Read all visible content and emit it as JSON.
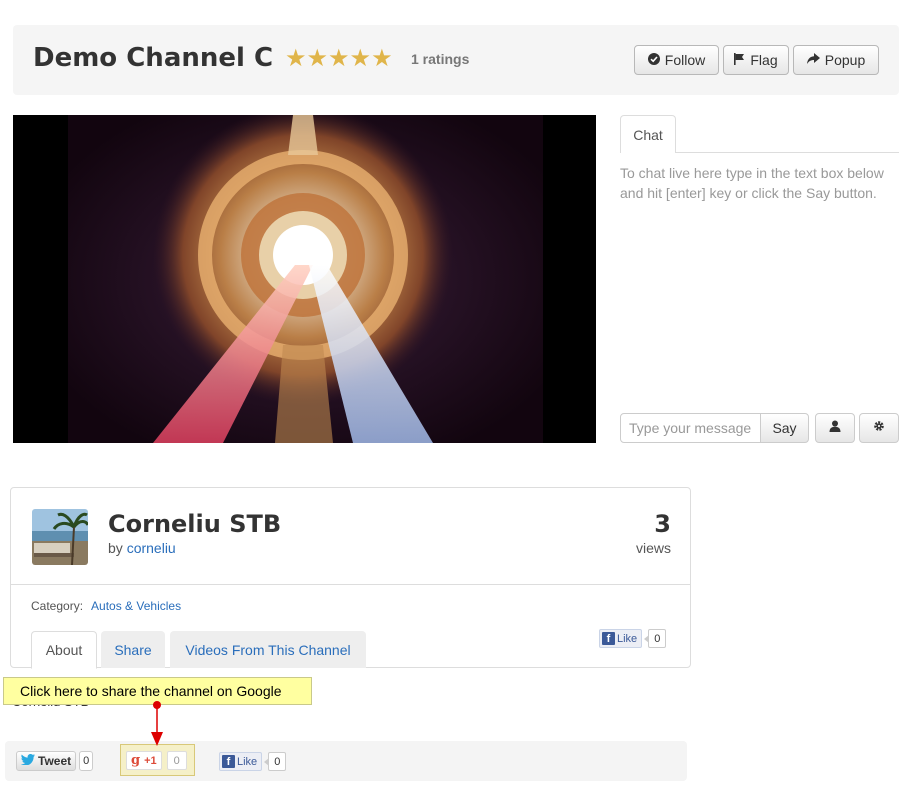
{
  "header": {
    "title": "Demo Channel C",
    "stars": "★★★★★",
    "ratings": "1 ratings",
    "follow_label": "Follow",
    "flag_label": "Flag",
    "popup_label": "Popup"
  },
  "chat": {
    "tab_label": "Chat",
    "help_text": "To chat live here type in the text box below and hit [enter] key or click the Say button.",
    "input_placeholder": "Type your message",
    "say_label": "Say"
  },
  "channel_info": {
    "name": "Corneliu STB",
    "by_label": "by",
    "owner": "corneliu",
    "views_count": "3",
    "views_label": "views",
    "category_label": "Category:",
    "category": "Autos & Vehicles",
    "tabs": [
      {
        "label": "About"
      },
      {
        "label": "Share"
      },
      {
        "label": "Videos From This Channel"
      }
    ],
    "fb_like_label": "Like",
    "fb_like_count": "0"
  },
  "tooltip": {
    "text": "Click here to share the channel on Google",
    "behind_text": "Corneliu STB"
  },
  "share_bar": {
    "tweet_label": "Tweet",
    "tweet_count": "0",
    "gplus_label": "+1",
    "gplus_count": "0",
    "fb_like_label": "Like",
    "fb_like_count": "0"
  },
  "colors": {
    "star": "#e0b54a",
    "link": "#2a6ebb",
    "tooltip_bg": "#ffffa0",
    "arrow": "#dd0000"
  }
}
